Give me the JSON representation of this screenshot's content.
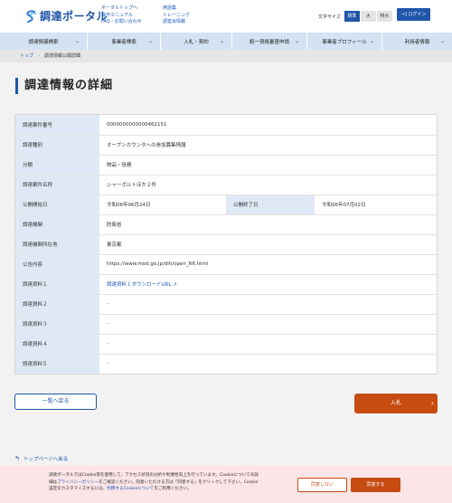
{
  "header": {
    "logo_text": "調達ポータル",
    "links_col1": [
      "ポータルトップへ",
      "操作マニュアル",
      "FAQ・お問い合わせ"
    ],
    "links_col2": [
      "用語集",
      "トレーニング",
      "調査会情報"
    ],
    "font_size_label": "文字サイズ",
    "font_sizes": [
      "標準",
      "大",
      "特大"
    ],
    "login_label": "ログイン",
    "brand_color": "#1f56a8"
  },
  "nav": {
    "items": [
      "調達情報検索",
      "事業者検索",
      "入札・契約",
      "統一資格審査申請",
      "事業者プロフィール",
      "利用者情報"
    ]
  },
  "breadcrumb": {
    "items": [
      "トップ",
      "調達情報公開詳細"
    ]
  },
  "page": {
    "title": "調達情報の詳細"
  },
  "details": {
    "case_number_label": "調達案件番号",
    "case_number": "0000000000000462151",
    "type_label": "調達種別",
    "type": "オープンカウンタへの参加募集情報",
    "category_label": "分類",
    "category": "物品・役務",
    "name_label": "調達案件名称",
    "name": "シャーボルトほか２件",
    "pub_start_label": "公開開始日",
    "pub_start": "令和06年06月24日",
    "pub_end_label": "公開終了日",
    "pub_end": "令和06年07月02日",
    "agency_label": "調達機関",
    "agency": "防衛省",
    "location_label": "調達機関所在地",
    "location": "東京都",
    "content_label": "公告内容",
    "content": "https://www.mod.go.jp/dih/open_R6.html",
    "doc1_label": "調達資料１",
    "doc1": "調達資料１ダウンロードURL",
    "doc2_label": "調達資料２",
    "doc2": "-",
    "doc3_label": "調達資料３",
    "doc3": "-",
    "doc4_label": "調達資料４",
    "doc4": "-",
    "doc5_label": "調達資料５",
    "doc5": "-"
  },
  "actions": {
    "back_label": "一覧へ戻る",
    "apply_label": "入札",
    "top_link": "トップページへ戻る",
    "accent_color": "#c64c12"
  },
  "cookie": {
    "line1": "調達ポータルではCookie等を使用して、アクセス状況の分析や利便性向上を行っています。Cookieについての詳",
    "line2_pre": "細は",
    "line2_link": "プライバシーポリシー",
    "line2_post": "をご確認ください。同意いただける方は「同意する」をクリックして下さい。Cookie",
    "line3_pre": "設定をカスタマイズするには、",
    "line3_link": "利用するCookieについて",
    "line3_post": "をご利用ください。",
    "deny_label": "同意しない",
    "accept_label": "同意する"
  }
}
